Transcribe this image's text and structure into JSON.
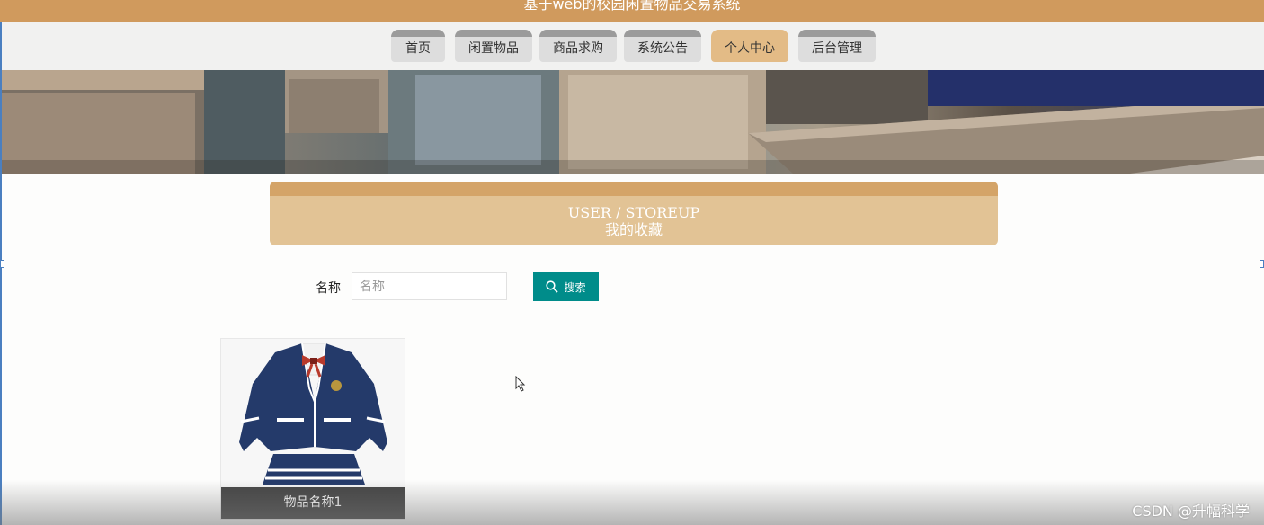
{
  "header": {
    "title": "基于web的校园闲置物品交易系统"
  },
  "nav": {
    "items": [
      {
        "label": "首页"
      },
      {
        "label": "闲置物品"
      },
      {
        "label": "商品求购"
      },
      {
        "label": "系统公告"
      },
      {
        "label": "个人中心"
      },
      {
        "label": "后台管理"
      }
    ],
    "active": "个人中心"
  },
  "page": {
    "title_en": "USER / STOREUP",
    "title_cn": "我的收藏"
  },
  "search": {
    "label": "名称",
    "placeholder": "名称",
    "button_label": "搜索"
  },
  "items": [
    {
      "name": "物品名称1"
    }
  ],
  "watermark": "CSDN @升幅科学",
  "colors": {
    "header": "#d09a5d",
    "accent": "#008c8a",
    "active_tab": "#e3bb86",
    "title_card": "#e2c395"
  }
}
